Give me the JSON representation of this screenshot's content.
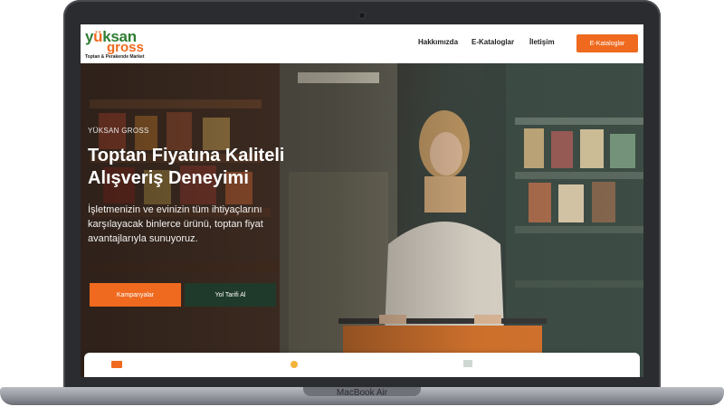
{
  "device": {
    "label": "MacBook Air"
  },
  "header": {
    "logo": {
      "top": "yüksan",
      "bottom": "gross",
      "tagline": "Toptan & Perakende Market"
    },
    "nav": [
      "Hakkımızda",
      "E-Kataloglar",
      "İletişim"
    ],
    "cta_label": "E-Kataloglar"
  },
  "hero": {
    "eyebrow": "YÜKSAN GROSS",
    "headline_line1": "Toptan Fiyatına Kaliteli",
    "headline_line2": "Alışveriş Deneyimi",
    "subtext": "İşletmenizin ve evinizin tüm ihtiyaçlarını karşılayacak binlerce ürünü, toptan fiyat avantajlarıyla sunuyoruz.",
    "primary_button": "Kampanyalar",
    "secondary_button": "Yol Tarifi Al"
  },
  "colors": {
    "accent": "#ef6a1f",
    "brand_green": "#2f7d32",
    "dark_green": "#1f3a2a"
  },
  "icons": [
    "shopping-bag-icon",
    "fruit-icon",
    "price-tag-icon"
  ]
}
